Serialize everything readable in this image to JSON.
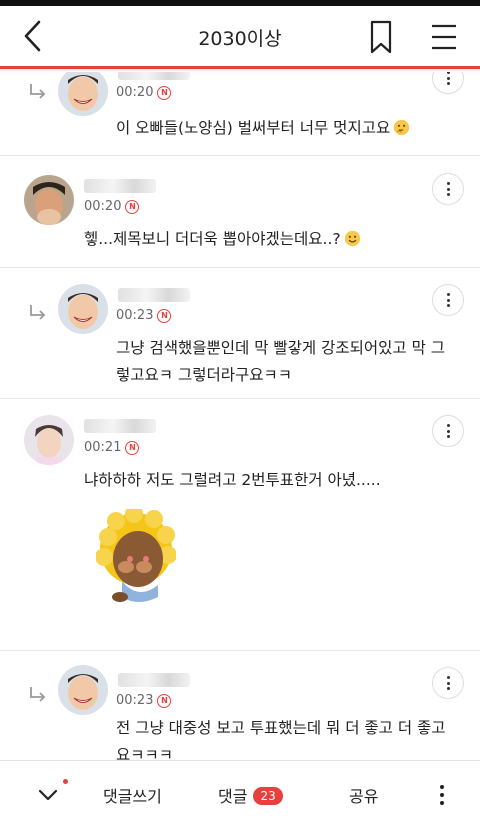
{
  "header": {
    "title": "2030이상",
    "back_icon": "chevron-left-icon",
    "bookmark_icon": "bookmark-icon",
    "menu_icon": "hamburger-menu-icon",
    "accent_color": "#e8413d"
  },
  "comments": [
    {
      "time": "00:20",
      "badge": "N",
      "text": "이 오빠들(노양심) 벌써부터 너무 멋지고요",
      "emoji": "thinking-face",
      "is_reply": true
    },
    {
      "time": "00:20",
      "badge": "N",
      "text": "헿...제목보니 더더욱 뽑아야겠는데요..?",
      "emoji": "smiling-face",
      "is_reply": false
    },
    {
      "time": "00:23",
      "badge": "N",
      "text_line1": "그냥 검색했을뿐인데 막 빨갛게 강조되어있고 막 그",
      "text_line2": "렇고요ㅋ 그렇더라구요ㅋㅋ",
      "is_reply": true
    },
    {
      "time": "00:21",
      "badge": "N",
      "text": "냐하하하 저도 그럴려고 2번투표한거 아녔.....",
      "sticker": "lion-character-sticker",
      "is_reply": false
    },
    {
      "time": "00:23",
      "badge": "N",
      "text_line1": "전 그냥 대중성 보고 투표했는데 뭐 더 좋고 더 좋고",
      "text_line2": "요ㅋㅋㅋ",
      "is_reply": true
    }
  ],
  "bottom_bar": {
    "collapse_icon": "chevron-down-icon",
    "write_label": "댓글쓰기",
    "comments_label": "댓글",
    "comments_count": "23",
    "share_label": "공유",
    "more_icon": "vertical-dots-icon"
  }
}
